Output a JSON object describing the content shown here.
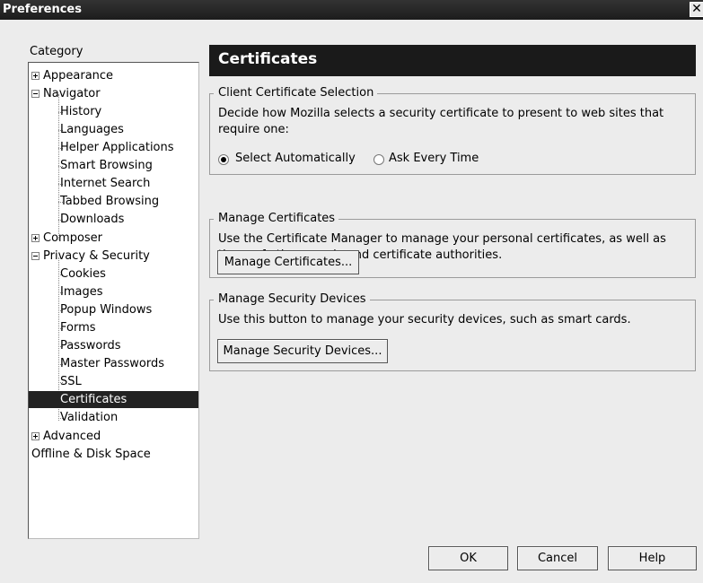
{
  "window": {
    "title": "Preferences",
    "close_glyph": "✕"
  },
  "sidebar": {
    "category_label": "Category",
    "items": [
      {
        "label": "Appearance",
        "expander": "plus"
      },
      {
        "label": "Navigator",
        "expander": "minus"
      },
      {
        "label": "History"
      },
      {
        "label": "Languages"
      },
      {
        "label": "Helper Applications"
      },
      {
        "label": "Smart Browsing"
      },
      {
        "label": "Internet Search"
      },
      {
        "label": "Tabbed Browsing"
      },
      {
        "label": "Downloads"
      },
      {
        "label": "Composer",
        "expander": "plus"
      },
      {
        "label": "Privacy & Security",
        "expander": "minus"
      },
      {
        "label": "Cookies"
      },
      {
        "label": "Images"
      },
      {
        "label": "Popup Windows"
      },
      {
        "label": "Forms"
      },
      {
        "label": "Passwords"
      },
      {
        "label": "Master Passwords"
      },
      {
        "label": "SSL"
      },
      {
        "label": "Certificates",
        "selected": true
      },
      {
        "label": "Validation"
      },
      {
        "label": "Advanced",
        "expander": "plus"
      },
      {
        "label": "Offline & Disk Space"
      }
    ]
  },
  "panel": {
    "title": "Certificates",
    "client_cert": {
      "legend": "Client Certificate Selection",
      "description": "Decide how Mozilla selects a security certificate to present to web sites that require one:",
      "options": [
        {
          "label": "Select Automatically",
          "checked": true
        },
        {
          "label": "Ask Every Time",
          "checked": false
        }
      ]
    },
    "manage_certs": {
      "legend": "Manage Certificates",
      "description": "Use the Certificate Manager to manage your personal certificates, as well as those of other people and certificate authorities.",
      "button_label": "Manage Certificates..."
    },
    "security_devices": {
      "legend": "Manage Security Devices",
      "description": "Use this button to manage your security devices, such as smart cards.",
      "button_label": "Manage Security Devices..."
    }
  },
  "footer": {
    "ok_label": "OK",
    "cancel_label": "Cancel",
    "help_label": "Help"
  }
}
